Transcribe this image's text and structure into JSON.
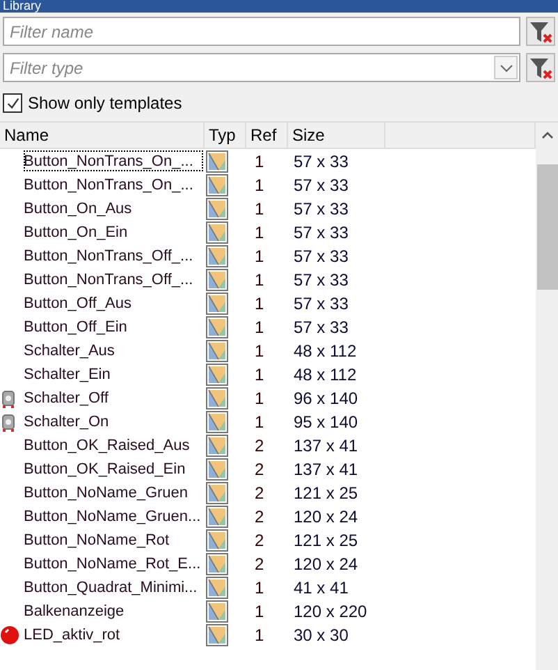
{
  "window": {
    "title": "Library"
  },
  "filters": {
    "name": {
      "placeholder": "Filter name"
    },
    "type": {
      "placeholder": "Filter type"
    }
  },
  "show_only_templates": {
    "label": "Show only templates",
    "checked": true
  },
  "table": {
    "columns": [
      "Name",
      "Typ",
      "Ref",
      "Size"
    ],
    "rows": [
      {
        "kind": "plain",
        "name": "Button_NonTrans_On_...",
        "ref": "1",
        "size": "57 x 33",
        "selected": true
      },
      {
        "kind": "plain",
        "name": "Button_NonTrans_On_...",
        "ref": "1",
        "size": "57 x 33",
        "selected": false
      },
      {
        "kind": "plain",
        "name": "Button_On_Aus",
        "ref": "1",
        "size": "57 x 33",
        "selected": false
      },
      {
        "kind": "plain",
        "name": "Button_On_Ein",
        "ref": "1",
        "size": "57 x 33",
        "selected": false
      },
      {
        "kind": "plain",
        "name": "Button_NonTrans_Off_...",
        "ref": "1",
        "size": "57 x 33",
        "selected": false
      },
      {
        "kind": "plain",
        "name": "Button_NonTrans_Off_...",
        "ref": "1",
        "size": "57 x 33",
        "selected": false
      },
      {
        "kind": "plain",
        "name": "Button_Off_Aus",
        "ref": "1",
        "size": "57 x 33",
        "selected": false
      },
      {
        "kind": "plain",
        "name": "Button_Off_Ein",
        "ref": "1",
        "size": "57 x 33",
        "selected": false
      },
      {
        "kind": "plain",
        "name": "Schalter_Aus",
        "ref": "1",
        "size": "48 x 112",
        "selected": false
      },
      {
        "kind": "plain",
        "name": "Schalter_Ein",
        "ref": "1",
        "size": "48 x 112",
        "selected": false
      },
      {
        "kind": "switch",
        "name": "Schalter_Off",
        "ref": "1",
        "size": "96 x 140",
        "selected": false
      },
      {
        "kind": "switch",
        "name": "Schalter_On",
        "ref": "1",
        "size": "95 x 140",
        "selected": false
      },
      {
        "kind": "plain",
        "name": "Button_OK_Raised_Aus",
        "ref": "2",
        "size": "137 x 41",
        "selected": false
      },
      {
        "kind": "plain",
        "name": "Button_OK_Raised_Ein",
        "ref": "2",
        "size": "137 x 41",
        "selected": false
      },
      {
        "kind": "plain",
        "name": "Button_NoName_Gruen",
        "ref": "2",
        "size": "121 x 25",
        "selected": false
      },
      {
        "kind": "plain",
        "name": "Button_NoName_Gruen...",
        "ref": "2",
        "size": "120 x 24",
        "selected": false
      },
      {
        "kind": "plain",
        "name": "Button_NoName_Rot",
        "ref": "2",
        "size": "121 x 25",
        "selected": false
      },
      {
        "kind": "plain",
        "name": "Button_NoName_Rot_E...",
        "ref": "2",
        "size": "120 x 24",
        "selected": false
      },
      {
        "kind": "plain",
        "name": "Button_Quadrat_Minimi...",
        "ref": "1",
        "size": "41 x 41",
        "selected": false
      },
      {
        "kind": "plain",
        "name": "Balkenanzeige",
        "ref": "1",
        "size": "120 x 220",
        "selected": false
      },
      {
        "kind": "led",
        "name": "LED_aktiv_rot",
        "ref": "1",
        "size": "30 x 30",
        "selected": false
      }
    ]
  }
}
